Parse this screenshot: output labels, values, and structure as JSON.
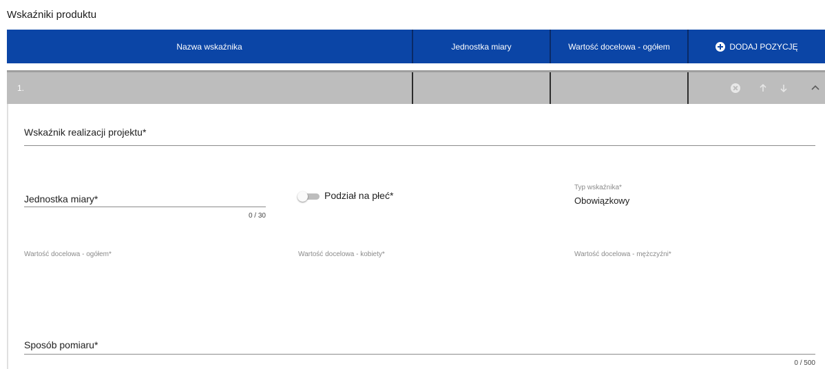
{
  "section": {
    "title": "Wskaźniki produktu"
  },
  "table": {
    "headers": {
      "name": "Nazwa wskaźnika",
      "unit": "Jednostka miary",
      "target_total": "Wartość docelowa - ogółem",
      "add_button": "DODAJ POZYCJĘ"
    },
    "header_bg": "#0b45a6",
    "row": {
      "index": "1.",
      "bg": "#bdbdbd"
    }
  },
  "icons": {
    "add": "plus-circle-icon",
    "remove": "close-circle-icon",
    "move_up": "arrow-up-icon",
    "move_down": "arrow-down-icon",
    "collapse": "chevron-up-icon"
  },
  "form": {
    "indicator": {
      "label": "Wskaźnik realizacji projektu*"
    },
    "unit": {
      "label": "Jednostka miary*",
      "counter": "0 / 30"
    },
    "gender_split": {
      "label": "Podział na płeć*",
      "enabled": false
    },
    "indicator_type": {
      "label": "Typ wskaźnika*",
      "value": "Obowiązkowy"
    },
    "target_total": {
      "label": "Wartość docelowa - ogółem*"
    },
    "target_women": {
      "label": "Wartość docelowa - kobiety*"
    },
    "target_men": {
      "label": "Wartość docelowa - mężczyźni*"
    },
    "measurement": {
      "label": "Sposób pomiaru*",
      "counter": "0 / 500"
    }
  }
}
